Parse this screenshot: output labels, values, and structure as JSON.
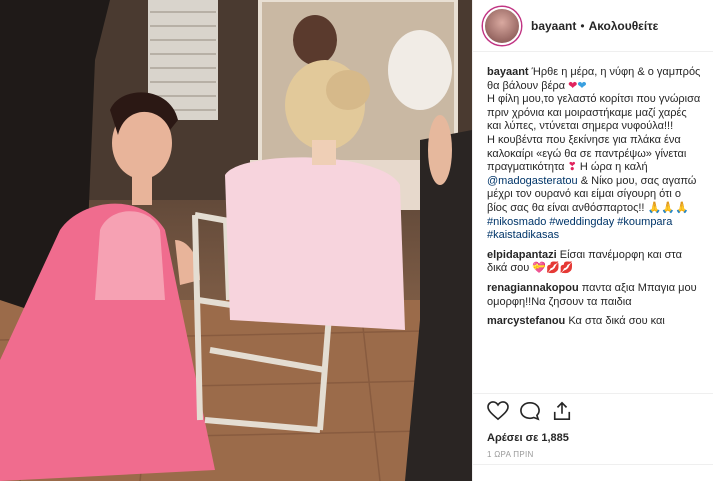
{
  "post": {
    "username": "bayaant",
    "follow_label": "Ακολουθείτε",
    "caption": {
      "author": "bayaant",
      "text1": "Ήρθε η μέρα, η νύφη & ο γαμπρός θα βάλουν βέρα",
      "text2": "Η φίλη μου,το γελαστό κορίτσι που γνώρισα πριν χρόνια και μοιραστήκαμε μαζί χαρές και λύπες, ντύνεται σημερα νυφούλα!!!",
      "text3": "Η κουβέντα που ξεκίνησε για πλάκα ένα καλοκαίρι «εγώ θα σε παντρέψω» γίνεται πραγματικότητα",
      "text4": "Η ώρα η καλή",
      "mention": "@madogasteratou",
      "text5": "& Νίκο μου, σας αγαπώ μέχρι τον ουρανό και είμαι σίγουρη ότι ο βίος σας θα είναι ανθόσπαρτος!!",
      "hashtags": [
        "#nikosmado",
        "#weddingday",
        "#koumpara",
        "#kaistadikasas"
      ]
    },
    "comments": [
      {
        "user": "elpidapantazi",
        "text": "Είσαι πανέμορφη και στα δικά σου"
      },
      {
        "user": "renagiannakopou",
        "text": "παντα αξια Μπαγια μου ομορφη!!Να ζησουν τα παιδια"
      },
      {
        "user": "marcystefanou",
        "text": "Κα στα δικά σου και"
      }
    ],
    "likes_label": "Αρέσει σε 1,885",
    "time_label": "1 ΩΡΑ ΠΡΙΝ"
  },
  "icons": [
    "heart-icon",
    "comment-icon",
    "share-icon"
  ],
  "colors": {
    "heart": "#e0245e",
    "blue_heart": "#3aa0e0",
    "mention": "#003569",
    "ring": "#c13584"
  }
}
